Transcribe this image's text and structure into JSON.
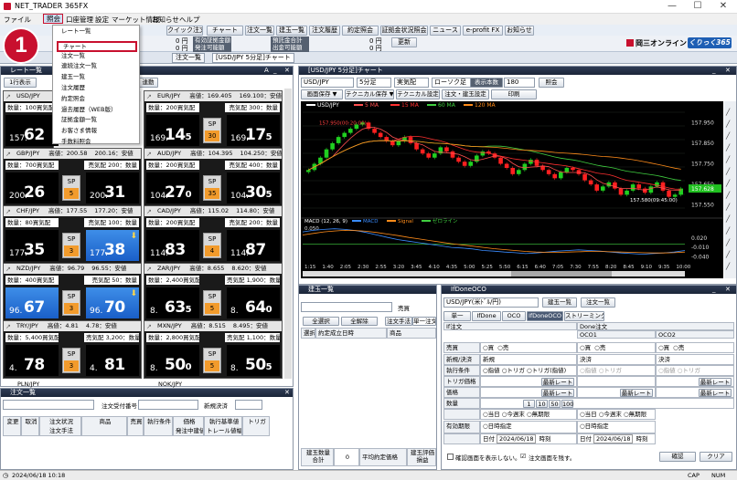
{
  "window": {
    "title": "NET_TRADER 365FX"
  },
  "menubar": [
    "ファイル",
    "",
    "照会",
    "口座管理",
    "設定",
    "マーケット情報",
    "お知らせ",
    "ヘルプ"
  ],
  "dropdown": {
    "items": [
      "レート一覧",
      "チャート",
      "注文一覧",
      "連続注文一覧",
      "建玉一覧",
      "注文履歴",
      "約定照会",
      "過去履歴（WEB版）",
      "証拠金額一覧",
      "お客さま情報",
      "手数料照会"
    ],
    "highlight_index": 1,
    "badge": "1"
  },
  "toolbar": {
    "buttons": [
      "クイック注文",
      "チャート",
      "注文一覧",
      "建玉一覧",
      "注文履歴",
      "約定照会",
      "証拠金状況照会",
      "ニュース",
      "e-profit FX",
      "お知らせ"
    ],
    "rows": [
      {
        "label": "有効証拠金額",
        "value": "0 円",
        "label2": "預託金合計",
        "value2": "0 円"
      },
      {
        "label": "発注可能額",
        "value": "0 円",
        "label2": "出金可能額",
        "value2": "0 円"
      }
    ],
    "refresh": "更新",
    "brand": "岡三オンライン",
    "brand_badge": "くりっく365"
  },
  "tabs": [
    "注文一覧",
    "[USD/JPY 5分足]チャート"
  ],
  "rates": {
    "title": "レート一覧",
    "toolbar_btn": "1行表示",
    "toolbar_btn2": "連動",
    "buy_label": "買気配",
    "sell_label": "売気配",
    "tiles": [
      {
        "pair": "USD/JPY",
        "high": "",
        "low": "",
        "qty_s": "100",
        "qty_b": "",
        "bid_s": "157.",
        "bid_b": "62",
        "ask_s": "",
        "ask_b": "",
        "sp1": "",
        "sp2": "",
        "hl_left": false,
        "hl_right": false,
        "partial": true
      },
      {
        "pair": "EUR/JPY",
        "high": "高値：169.405",
        "low": "169.100：安値",
        "qty_s": "200",
        "qty_b": "300",
        "bid_s": "169.",
        "bid_b": "14",
        "bid_x": "5",
        "ask_s": "169.",
        "ask_b": "17",
        "ask_x": "5",
        "sp1": "SP",
        "sp2": "30",
        "hl_left": false,
        "hl_right": false
      },
      {
        "pair": "GBP/JPY",
        "high": "高値：200.58",
        "low": "200.16：安値",
        "qty_s": "700",
        "qty_b": "200",
        "bid_s": "200.",
        "bid_b": "26",
        "bid_x": "",
        "ask_s": "200.",
        "ask_b": "31",
        "ask_x": "",
        "sp1": "SP",
        "sp2": "5",
        "hl_left": false,
        "hl_right": false
      },
      {
        "pair": "AUD/JPY",
        "high": "高値：104.395",
        "low": "104.250：安値",
        "qty_s": "200",
        "qty_b": "400",
        "bid_s": "104.",
        "bid_b": "27",
        "bid_x": "0",
        "ask_s": "104.",
        "ask_b": "30",
        "ask_x": "5",
        "sp1": "SP",
        "sp2": "35",
        "hl_left": false,
        "hl_right": false
      },
      {
        "pair": "CHF/JPY",
        "high": "高値：177.55",
        "low": "177.20：安値",
        "qty_s": "80",
        "qty_b": "100",
        "bid_s": "177.",
        "bid_b": "35",
        "bid_x": "",
        "ask_s": "177.",
        "ask_b": "38",
        "ask_x": "",
        "sp1": "SP",
        "sp2": "3",
        "hl_left": false,
        "hl_right": true
      },
      {
        "pair": "CAD/JPY",
        "high": "高値：115.02",
        "low": "114.80：安値",
        "qty_s": "200",
        "qty_b": "200",
        "bid_s": "114.",
        "bid_b": "83",
        "bid_x": "",
        "ask_s": "114.",
        "ask_b": "87",
        "ask_x": "",
        "sp1": "SP",
        "sp2": "4",
        "hl_left": false,
        "hl_right": false
      },
      {
        "pair": "NZD/JPY",
        "high": "高値：96.79",
        "low": "96.55：安値",
        "qty_s": "400",
        "qty_b": "50",
        "bid_s": "96.",
        "bid_b": "67",
        "bid_x": "",
        "ask_s": "96.",
        "ask_b": "70",
        "ask_x": "",
        "sp1": "SP",
        "sp2": "3",
        "hl_left": true,
        "hl_right": true
      },
      {
        "pair": "ZAR/JPY",
        "high": "高値：8.655",
        "low": "8.620：安値",
        "qty_s": "2,400",
        "qty_b": "1,900",
        "bid_s": "8.",
        "bid_b": "63",
        "bid_x": "5",
        "ask_s": "8.",
        "ask_b": "64",
        "ask_x": "0",
        "sp1": "SP",
        "sp2": "5",
        "hl_left": false,
        "hl_right": false
      },
      {
        "pair": "TRY/JPY",
        "high": "高値：4.81",
        "low": "4.78：安値",
        "qty_s": "5,400",
        "qty_b": "3,200",
        "bid_s": "4.",
        "bid_b": "78",
        "bid_x": "",
        "ask_s": "4.",
        "ask_b": "81",
        "ask_x": "",
        "sp1": "SP",
        "sp2": "3",
        "hl_left": false,
        "hl_right": false
      },
      {
        "pair": "MXN/JPY",
        "high": "高値：8.515",
        "low": "8.495：安値",
        "qty_s": "2,800",
        "qty_b": "1,100",
        "bid_s": "8.",
        "bid_b": "50",
        "bid_x": "0",
        "ask_s": "8.",
        "ask_b": "50",
        "ask_x": "5",
        "sp1": "SP",
        "sp2": "5",
        "hl_left": false,
        "hl_right": false
      }
    ],
    "bottom_pairs": [
      "PLN/JPY",
      "NOK/JPY"
    ]
  },
  "chart": {
    "title": "[USD/JPY 5分足]チャート",
    "controls": [
      "USD/JPY",
      "5分足",
      "実気配",
      "ローソク足",
      "表示本数",
      "180",
      "照会"
    ],
    "buttons2": [
      "画面保存 ▼",
      "テクニカル保存 ▼",
      "テクニカル設定",
      "注文・建玉設定",
      "印刷"
    ],
    "legend": [
      {
        "name": "USD/JPY",
        "color": "#ffffff"
      },
      {
        "name": "5 MA",
        "color": "#ff5050"
      },
      {
        "name": "15 MA",
        "color": "#ff3030"
      },
      {
        "name": "60 MA",
        "color": "#40d040"
      },
      {
        "name": "120 MA",
        "color": "#ff8c1a"
      }
    ],
    "price_ticks": [
      "157.950",
      "157.850",
      "157.750",
      "157.650",
      "157.628",
      "157.550"
    ],
    "annot_high": "157.950(00:20:00)",
    "annot_low": "157.580(09:45:00)",
    "macd_legend": [
      {
        "name": "MACD (12, 26, 9)",
        "color": "#ffffff"
      },
      {
        "name": "MACD",
        "color": "#3a8cff"
      },
      {
        "name": "Signal",
        "color": "#ff8c1a"
      },
      {
        "name": "ゼロライン",
        "color": "#40d040"
      }
    ],
    "macd_value": "0.050",
    "macd_ticks": [
      "0.020",
      "-0.010",
      "-0.040"
    ],
    "time_ticks": [
      "1:15",
      "1:40",
      "2:05",
      "2:30",
      "2:55",
      "3:20",
      "3:45",
      "4:10",
      "4:35",
      "5:00",
      "5:25",
      "5:50",
      "6:15",
      "6:40",
      "7:05",
      "7:30",
      "7:55",
      "8:20",
      "8:45",
      "9:10",
      "9:35",
      "10:00"
    ],
    "colors": {
      "bg": "#000000",
      "up": "#20d020",
      "down": "#ff2020"
    }
  },
  "chart_data": {
    "type": "candlestick",
    "title": "",
    "x_tick_labels": [
      "1:15",
      "1:40",
      "2:05",
      "2:30",
      "2:55",
      "3:20",
      "3:45",
      "4:10",
      "4:35",
      "5:00",
      "5:25",
      "5:50",
      "6:15",
      "6:40",
      "7:05",
      "7:30",
      "7:55",
      "8:20",
      "8:45",
      "9:10",
      "9:35",
      "10:00"
    ],
    "ylim": [
      157.5,
      158.0
    ],
    "last": 157.628,
    "close": [
      157.72,
      157.75,
      157.78,
      157.82,
      157.85,
      157.88,
      157.9,
      157.92,
      157.94,
      157.95,
      157.92,
      157.9,
      157.88,
      157.86,
      157.84,
      157.86,
      157.88,
      157.85,
      157.82,
      157.8,
      157.78,
      157.8,
      157.83,
      157.81,
      157.78,
      157.76,
      157.74,
      157.76,
      157.79,
      157.81,
      157.8,
      157.78,
      157.75,
      157.73,
      157.7,
      157.72,
      157.75,
      157.77,
      157.74,
      157.72,
      157.7,
      157.68,
      157.71,
      157.73,
      157.72,
      157.7,
      157.67,
      157.65,
      157.62,
      157.64,
      157.66,
      157.63,
      157.6,
      157.62,
      157.65,
      157.63,
      157.61,
      157.64,
      157.66,
      157.62,
      157.59,
      157.6,
      157.63
    ],
    "macd": [
      0.04,
      0.045,
      0.048,
      0.05,
      0.048,
      0.044,
      0.038,
      0.03,
      0.022,
      0.015,
      0.01,
      0.005,
      0.0,
      -0.005,
      -0.01,
      -0.012,
      -0.015,
      -0.02,
      -0.022,
      -0.025,
      -0.027,
      -0.03,
      -0.028,
      -0.025,
      -0.022,
      -0.02,
      -0.018,
      -0.02,
      -0.022,
      -0.025,
      -0.028,
      -0.03,
      -0.032,
      -0.03,
      -0.028,
      -0.025,
      -0.02
    ],
    "signal": [
      0.03,
      0.035,
      0.04,
      0.043,
      0.045,
      0.044,
      0.042,
      0.038,
      0.033,
      0.028,
      0.022,
      0.017,
      0.012,
      0.007,
      0.002,
      -0.002,
      -0.006,
      -0.01,
      -0.014,
      -0.017,
      -0.02,
      -0.023,
      -0.025,
      -0.026,
      -0.026,
      -0.025,
      -0.024,
      -0.023,
      -0.023,
      -0.024,
      -0.025,
      -0.026,
      -0.027,
      -0.028,
      -0.028,
      -0.027,
      -0.025
    ]
  },
  "orders_list": {
    "title": "注文一覧",
    "order_no_label": "注文受付番号",
    "new_label": "新規決済",
    "cols": [
      "変更",
      "取消",
      "注文状況",
      "商品",
      "売買",
      "執行条件",
      "価格",
      "執行基準値",
      "トリガ"
    ],
    "cols2": [
      "",
      "",
      "注文手法",
      "",
      "",
      "",
      "発注中建値",
      "トレール値幅",
      ""
    ]
  },
  "positions": {
    "title": "建玉一覧",
    "btn_all": "全選択",
    "btn_clear": "全解除",
    "btn_method": "注文手法",
    "btn_single": "単一注文",
    "sell_label": "売買",
    "cols": [
      "選択",
      "約定成立日時",
      "商品"
    ],
    "footer": [
      "建玉数量合計",
      "0",
      "平均約定価格",
      "建玉評価損益"
    ]
  },
  "ifdone": {
    "title": "IfDoneOCO",
    "pair": "USD/JPY(米ﾄﾞﾙ/円)",
    "btn_pos": "建玉一覧",
    "btn_orders": "注文一覧",
    "tabs": [
      "単一",
      "IfDone",
      "OCO",
      "IfDoneOCO",
      "ストリーミング"
    ],
    "done_label": "Done注文",
    "if_label": "If注文",
    "oco1": "OCO1",
    "oco2": "OCO2",
    "rows": [
      "売買",
      "新規/決済",
      "執行条件",
      "トリガ価格",
      "価格",
      "数量",
      "",
      "有効期限",
      ""
    ],
    "opt_sell": "○売",
    "opt_buy": "○買",
    "new": "新規",
    "settle": "決済",
    "exec": "○指値 ○トリガ ○トリガ(指値)",
    "exec_oco": "○指値 ○トリガ",
    "latest": "最新レート",
    "qty_btns": [
      "1",
      "10",
      "50",
      "100"
    ],
    "expiry1": "○当日 ○今週末 ○無期限",
    "expiry2": "○日時指定",
    "date": "日付",
    "date_val": "2024/06/18",
    "time": "時刻",
    "confirm_check": "確認画面を表示しない。",
    "keep_check": "注文画面を残す。",
    "confirm": "確認",
    "clear": "クリア"
  },
  "status": {
    "datetime": "2024/06/18 10:18",
    "cap": "CAP",
    "num": "NUM"
  }
}
